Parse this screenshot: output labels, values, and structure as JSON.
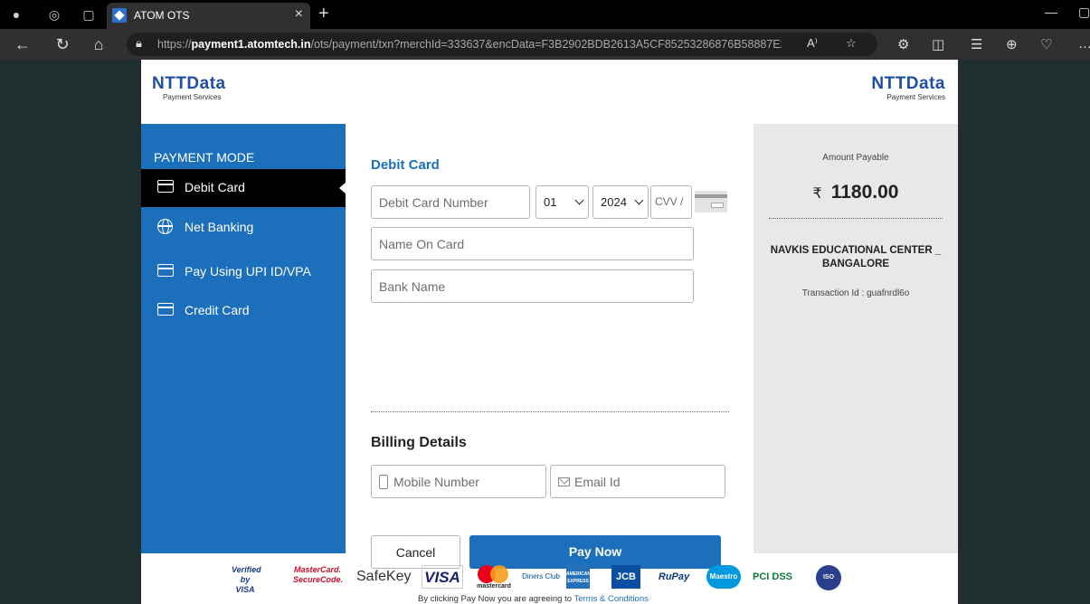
{
  "browser": {
    "tab_title": "ATOM OTS",
    "tab_close": "×",
    "new_tab": "+",
    "url_prefix": "https://",
    "url_host": "payment1.atomtech.in",
    "url_path": "/ots/payment/txn?merchId=333637&encData=F3B2902BDB2613A5CF85253286876B58887E2...",
    "read_aloud": "A⁾"
  },
  "logo": {
    "main": "NTTData",
    "sub": "Payment Services"
  },
  "sidebar": {
    "title": "PAYMENT MODE",
    "items": [
      {
        "label": "Debit Card",
        "active": true
      },
      {
        "label": "Net Banking"
      },
      {
        "label": "Pay Using UPI ID/VPA"
      },
      {
        "label": "Credit Card"
      }
    ]
  },
  "form": {
    "heading": "Debit Card",
    "card_number_placeholder": "Debit Card Number",
    "month_value": "01",
    "year_value": "2024",
    "cvv_placeholder": "CVV /",
    "name_placeholder": "Name On Card",
    "bank_placeholder": "Bank Name",
    "billing_heading": "Billing Details",
    "mobile_placeholder": "Mobile Number",
    "email_placeholder": "Email Id",
    "cancel_label": "Cancel",
    "pay_label": "Pay Now",
    "agree_text": "By clicking Pay Now you are agreeing to",
    "terms_link": "Terms & Conditions"
  },
  "summary": {
    "amount_label": "Amount Payable",
    "currency": "₹",
    "amount": "1180.00",
    "merchant": "NAVKIS EDUCATIONAL CENTER _ BANGALORE",
    "txn_label": "Transaction Id : guafnrdl6o"
  },
  "badges": [
    "Verified by VISA",
    "MasterCard. SecureCode.",
    "SafeKey",
    "VISA",
    "mastercard",
    "Diners Club",
    "AMERICAN EXPRESS",
    "JCB",
    "RuPay",
    "Maestro",
    "PCI DSS",
    "ISO"
  ]
}
